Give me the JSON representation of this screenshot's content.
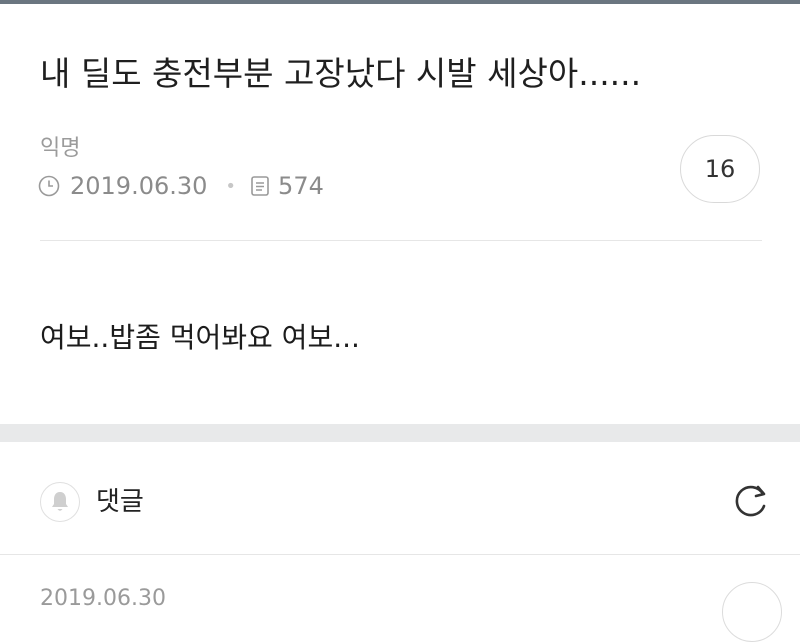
{
  "post": {
    "title": "내 딜도 충전부분 고장났다 시발 세상아......",
    "author": "익명",
    "date": "2019.06.30",
    "views": "574",
    "comment_count": "16",
    "body": "여보..밥좀 먹어봐요 여보..."
  },
  "comments": {
    "label": "댓글",
    "first_date": "2019.06.30"
  },
  "icons": {
    "date": "clock-icon",
    "views": "document-icon",
    "comments": "bell-icon",
    "refresh": "refresh-icon"
  }
}
